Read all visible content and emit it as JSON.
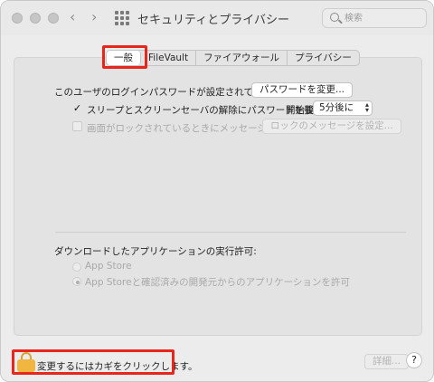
{
  "window": {
    "title": "セキュリティとプライバシー",
    "nav": {
      "back_icon": "‹",
      "forward_icon": "›"
    },
    "search": {
      "placeholder": "検索"
    }
  },
  "tabs": [
    {
      "label": "一般",
      "active": true
    },
    {
      "label": "FileVault",
      "active": false
    },
    {
      "label": "ファイアウォール",
      "active": false
    },
    {
      "label": "プライバシー",
      "active": false
    }
  ],
  "general": {
    "password_text": "このユーザのログインパスワードが設定されています",
    "change_password_button": "パスワードを変更...",
    "require_password": {
      "checked": true,
      "label": "スリープとスクリーンセーバの解除にパスワードを要求",
      "start_label": "開始後:",
      "delay_value": "5分後に"
    },
    "lock_message": {
      "checked": false,
      "label": "画面がロックされているときにメッセージを表示",
      "button": "ロックのメッセージを設定..."
    },
    "downloads": {
      "heading": "ダウンロードしたアプリケーションの実行許可:",
      "options": [
        {
          "label": "App Store",
          "selected": false
        },
        {
          "label": "App Storeと確認済みの開発元からのアプリケーションを許可",
          "selected": true
        }
      ]
    }
  },
  "footer": {
    "lock_label": "変更するにはカギをクリックします。",
    "advanced_button": "詳細...",
    "help_button": "?"
  },
  "colors": {
    "highlight": "#e8261b",
    "lock": "#f1b640"
  }
}
